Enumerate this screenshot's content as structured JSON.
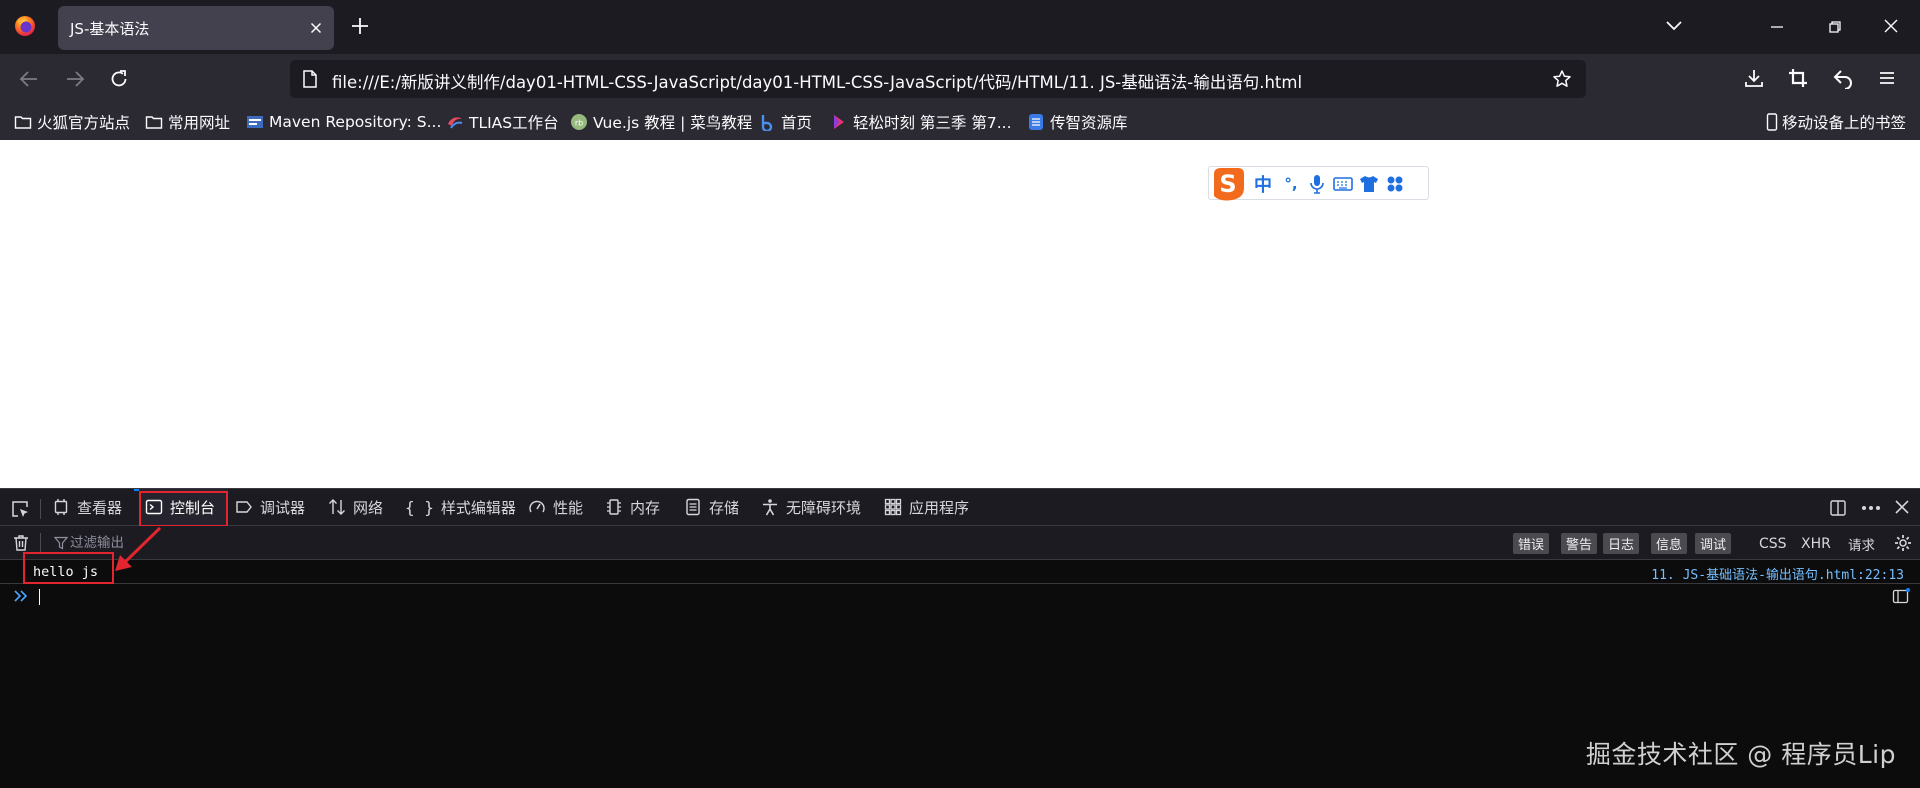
{
  "tab": {
    "title": "JS-基本语法"
  },
  "urlbar": {
    "url": "file:///E:/新版讲义制作/day01-HTML-CSS-JavaScript/day01-HTML-CSS-JavaScript/代码/HTML/11. JS-基础语法-输出语句.html"
  },
  "bookmarks": {
    "items": [
      {
        "label": "火狐官方站点",
        "icon": "folder-icon"
      },
      {
        "label": "常用网址",
        "icon": "folder-icon"
      },
      {
        "label": "Maven Repository: S...",
        "icon": "maven-icon"
      },
      {
        "label": "TLIAS工作台",
        "icon": "tlias-icon"
      },
      {
        "label": "Vue.js 教程 | 菜鸟教程",
        "icon": "runoob-icon"
      },
      {
        "label": "首页",
        "icon": "baidu-icon"
      },
      {
        "label": "轻松时刻 第三季 第7...",
        "icon": "video-icon"
      },
      {
        "label": "传智资源库",
        "icon": "database-icon"
      }
    ],
    "mobile": "移动设备上的书签"
  },
  "ime": {
    "lang": "中",
    "punct": "°,"
  },
  "devtools": {
    "tabs": [
      {
        "label": "查看器",
        "icon": "inspector-icon"
      },
      {
        "label": "控制台",
        "icon": "console-icon"
      },
      {
        "label": "调试器",
        "icon": "debugger-icon"
      },
      {
        "label": "网络",
        "icon": "network-icon"
      },
      {
        "label": "样式编辑器",
        "icon": "style-editor-icon"
      },
      {
        "label": "性能",
        "icon": "performance-icon"
      },
      {
        "label": "内存",
        "icon": "memory-icon"
      },
      {
        "label": "存储",
        "icon": "storage-icon"
      },
      {
        "label": "无障碍环境",
        "icon": "accessibility-icon"
      },
      {
        "label": "应用程序",
        "icon": "application-icon"
      }
    ],
    "filter_placeholder": "过滤输出",
    "levels": [
      "错误",
      "警告",
      "日志",
      "信息",
      "调试"
    ],
    "types": [
      "CSS",
      "XHR",
      "请求"
    ],
    "log": {
      "message": "hello js",
      "source": "11. JS-基础语法-输出语句.html:22:13"
    }
  },
  "watermark": "掘金技术社区 @ 程序员Lip",
  "colors": {
    "highlight_red": "#e3252f",
    "accent_blue": "#0a84ff",
    "source_link": "#75bfff"
  }
}
